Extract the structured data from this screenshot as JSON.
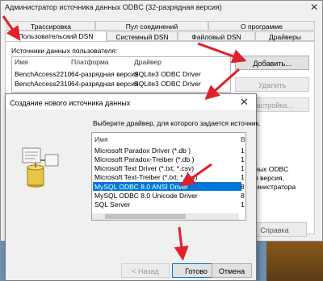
{
  "odbc_window": {
    "title": "Администратор источника данных ODBC (32-разрядная версия)",
    "tabs": [
      {
        "label": "Трассировка"
      },
      {
        "label": "Пул соединений"
      },
      {
        "label": "О программе"
      },
      {
        "label": "Пользовательский DSN"
      },
      {
        "label": "Системный DSN"
      },
      {
        "label": "Файловый DSN"
      },
      {
        "label": "Драйверы"
      }
    ],
    "user_sources_label": "Источники данных пользователя:",
    "columns": [
      "Имя",
      "Платформа",
      "Драйвер"
    ],
    "rows": [
      {
        "name": "BenchAccess2210",
        "platform": "64-разрядная версия",
        "driver": "SQLite3 ODBC Driver"
      },
      {
        "name": "BenchAccess2310",
        "platform": "64-разрядная версия",
        "driver": "SQLite3 ODBC Driver"
      }
    ],
    "buttons": {
      "add": "Добавить...",
      "remove": "Удалить",
      "configure": "Настройка..."
    },
    "info_lines": [
      "данных ODBC",
      "нная версия,",
      "администратора"
    ],
    "help_button": "Справка"
  },
  "dialog": {
    "title": "Создание нового источника данных",
    "instruction": "Выберите драйвер, для которого задается источник.",
    "list_header": "Имя",
    "list_header_version": "В",
    "drivers": [
      {
        "name": "Microsoft Paradox Driver (*.db )",
        "ver": "1"
      },
      {
        "name": "Microsoft Paradox-Treiber (*.db )",
        "ver": "1"
      },
      {
        "name": "Microsoft Text Driver (*.txt; *.csv)",
        "ver": "1"
      },
      {
        "name": "Microsoft Text-Treiber (*.txt; *.csv)",
        "ver": "1"
      },
      {
        "name": "MySQL ODBC 8.0 ANSI Driver",
        "ver": "8"
      },
      {
        "name": "MySQL ODBC 8.0 Unicode Driver",
        "ver": "8"
      },
      {
        "name": "SQL Server",
        "ver": "1"
      }
    ],
    "selected_index": 4,
    "buttons": {
      "back": "< Назад",
      "finish": "Готово",
      "cancel": "Отмена"
    }
  },
  "colors": {
    "selection": "#0078d7",
    "arrow": "#e0202a"
  }
}
